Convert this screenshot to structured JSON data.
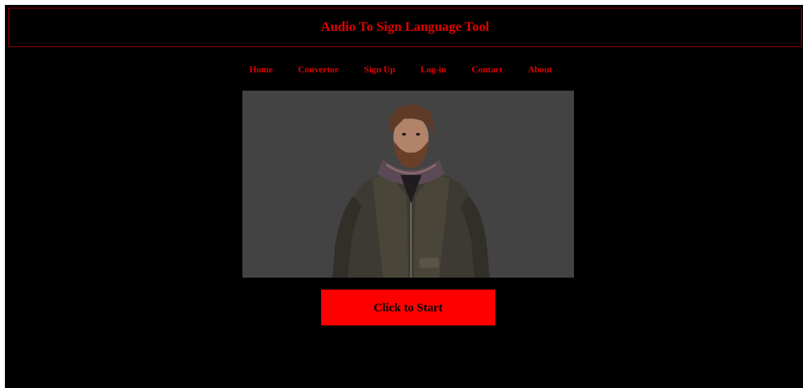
{
  "header": {
    "title": "Audio To Sign Language Tool"
  },
  "nav": {
    "items": [
      "Home",
      "Convertor",
      "Sign Up",
      "Log-in",
      "Contact",
      "About"
    ]
  },
  "avatar": {
    "icon": "3d-avatar-person"
  },
  "action": {
    "start_label": "Click to Start"
  },
  "colors": {
    "background": "#000000",
    "accent": "#ff0000",
    "viewport": "#434343"
  }
}
